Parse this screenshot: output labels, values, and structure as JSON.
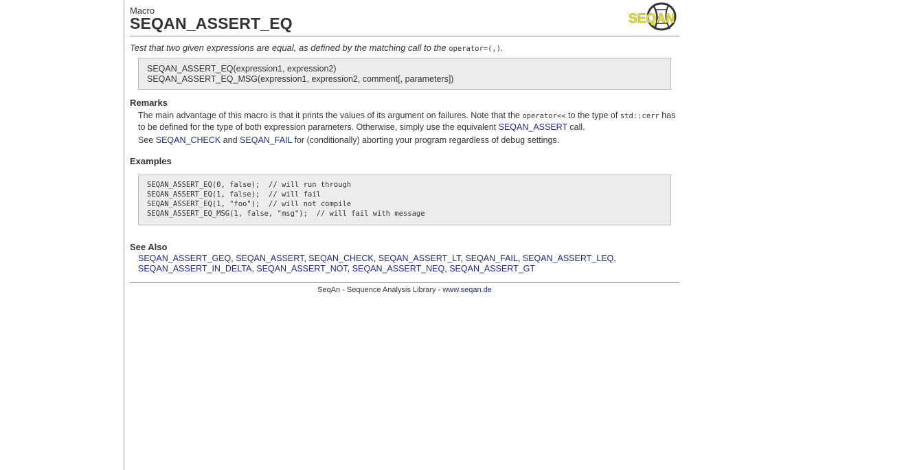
{
  "header": {
    "kind": "Macro",
    "title": "SEQAN_ASSERT_EQ",
    "logo_text": "SEQAN"
  },
  "summary": {
    "text": "Test that two given expressions are equal, as defined by the matching call to the",
    "code": "operator=(,)",
    "end": "."
  },
  "signatures": [
    "SEQAN_ASSERT_EQ(expression1, expression2)",
    "SEQAN_ASSERT_EQ_MSG(expression1, expression2, comment[, parameters])"
  ],
  "remarks": {
    "title": "Remarks",
    "p1_a": "The main advantage of this macro is that it prints the values of its argument on failures. Note that the",
    "p1_code1": "operator<<",
    "p1_b": "to the type of",
    "p1_code2": "std::cerr",
    "p1_c": "has to be defined for the type of both expression parameters. Otherwise, simply use the equivalent",
    "p1_link": "SEQAN_ASSERT",
    "p1_d": "call.",
    "p2_a": "See",
    "p2_link1": "SEQAN_CHECK",
    "p2_b": "and",
    "p2_link2": "SEQAN_FAIL",
    "p2_c": "for (conditionally) aborting your program regardless of debug settings."
  },
  "examples": {
    "title": "Examples",
    "code": "SEQAN_ASSERT_EQ(0, false);  // will run through\nSEQAN_ASSERT_EQ(1, false);  // will fail\nSEQAN_ASSERT_EQ(1, \"foo\");  // will not compile\nSEQAN_ASSERT_EQ_MSG(1, false, \"msg\");  // will fail with message"
  },
  "see_also": {
    "title": "See Also",
    "links": [
      "SEQAN_ASSERT_GEQ",
      "SEQAN_ASSERT",
      "SEQAN_CHECK",
      "SEQAN_ASSERT_LT",
      "SEQAN_FAIL",
      "SEQAN_ASSERT_LEQ",
      "SEQAN_ASSERT_IN_DELTA",
      "SEQAN_ASSERT_NOT",
      "SEQAN_ASSERT_NEQ",
      "SEQAN_ASSERT_GT"
    ]
  },
  "footer": {
    "text": "SeqAn - Sequence Analysis Library -",
    "link": "www.seqan.de"
  },
  "colors": {
    "link": "#1f2a87",
    "box_bg": "#ececec",
    "logo_yellow": "#e8e03a"
  }
}
